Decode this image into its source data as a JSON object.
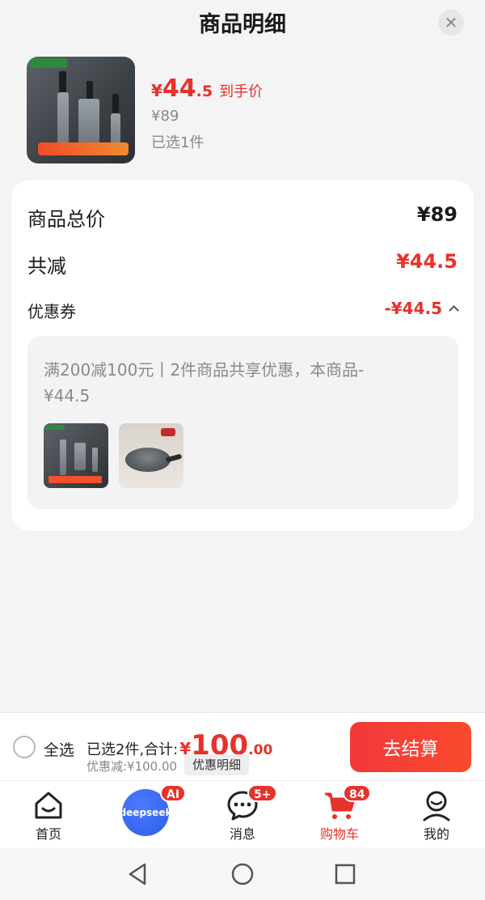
{
  "sheet": {
    "title": "商品明细",
    "close_icon": "close-icon"
  },
  "product": {
    "price_symbol": "¥",
    "price_int": "44",
    "price_dec": ".5",
    "price_tag": "到手价",
    "original_price": "¥89",
    "selected": "已选1件"
  },
  "breakdown": {
    "total_label": "商品总价",
    "total_value": "¥89",
    "reduced_label": "共减",
    "reduced_value": "¥44.5",
    "coupon_label": "优惠券",
    "coupon_value": "-¥44.5",
    "coupon_desc": "满200减100元丨2件商品共享优惠，本商品-¥44.5"
  },
  "checkout": {
    "select_all": "全选",
    "summary": "已选2件,合计:",
    "total_symbol": "¥",
    "total_int": "100",
    "total_dec": ".00",
    "discount": "优惠减:¥100.00",
    "detail_button": "优惠明细",
    "checkout_button": "去结算"
  },
  "tabbar": {
    "home": "首页",
    "deepseek": "deepseek",
    "deepseek_badge": "AI",
    "messages": "消息",
    "messages_badge": "5+",
    "cart": "购物车",
    "cart_badge": "84",
    "mine": "我的"
  },
  "colors": {
    "accent": "#e8312a",
    "deepseek": "#2f5de8"
  }
}
